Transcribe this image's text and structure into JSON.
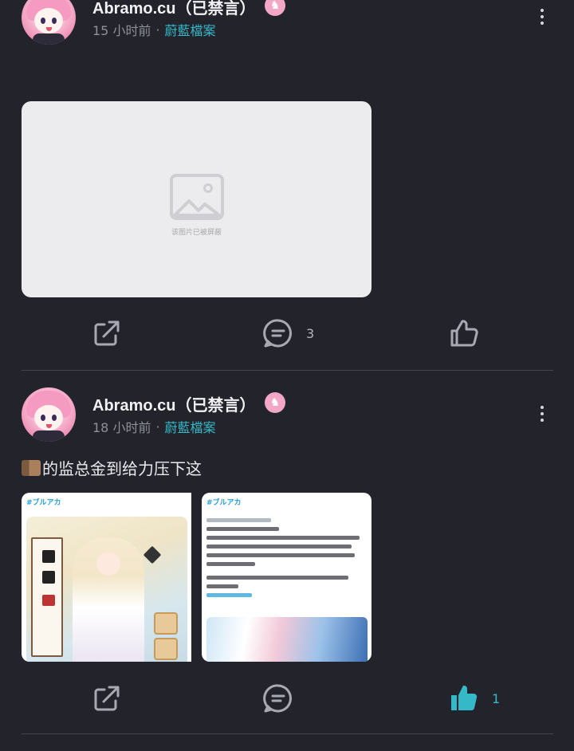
{
  "posts": [
    {
      "author": "Abramo.cu（已禁言）",
      "time": "15 小时前",
      "separator": "·",
      "channel": "蔚藍檔案",
      "image_blocked_text": "该图片已被屏蔽",
      "actions": {
        "comment_count": "3",
        "like_count": "",
        "liked": false
      }
    },
    {
      "author": "Abramo.cu（已禁言）",
      "time": "18 小时前",
      "separator": "·",
      "channel": "蔚藍檔案",
      "text": "的监总金到给力压下这",
      "images": [
        {
          "tag": "#ブルアカ"
        },
        {
          "tag": "#ブルアカ"
        }
      ],
      "actions": {
        "comment_count": "",
        "like_count": "1",
        "liked": true
      }
    }
  ],
  "colors": {
    "background": "#23242b",
    "accent": "#35b9c9",
    "meta": "#8d8f99",
    "icon": "#a7a9b3"
  }
}
